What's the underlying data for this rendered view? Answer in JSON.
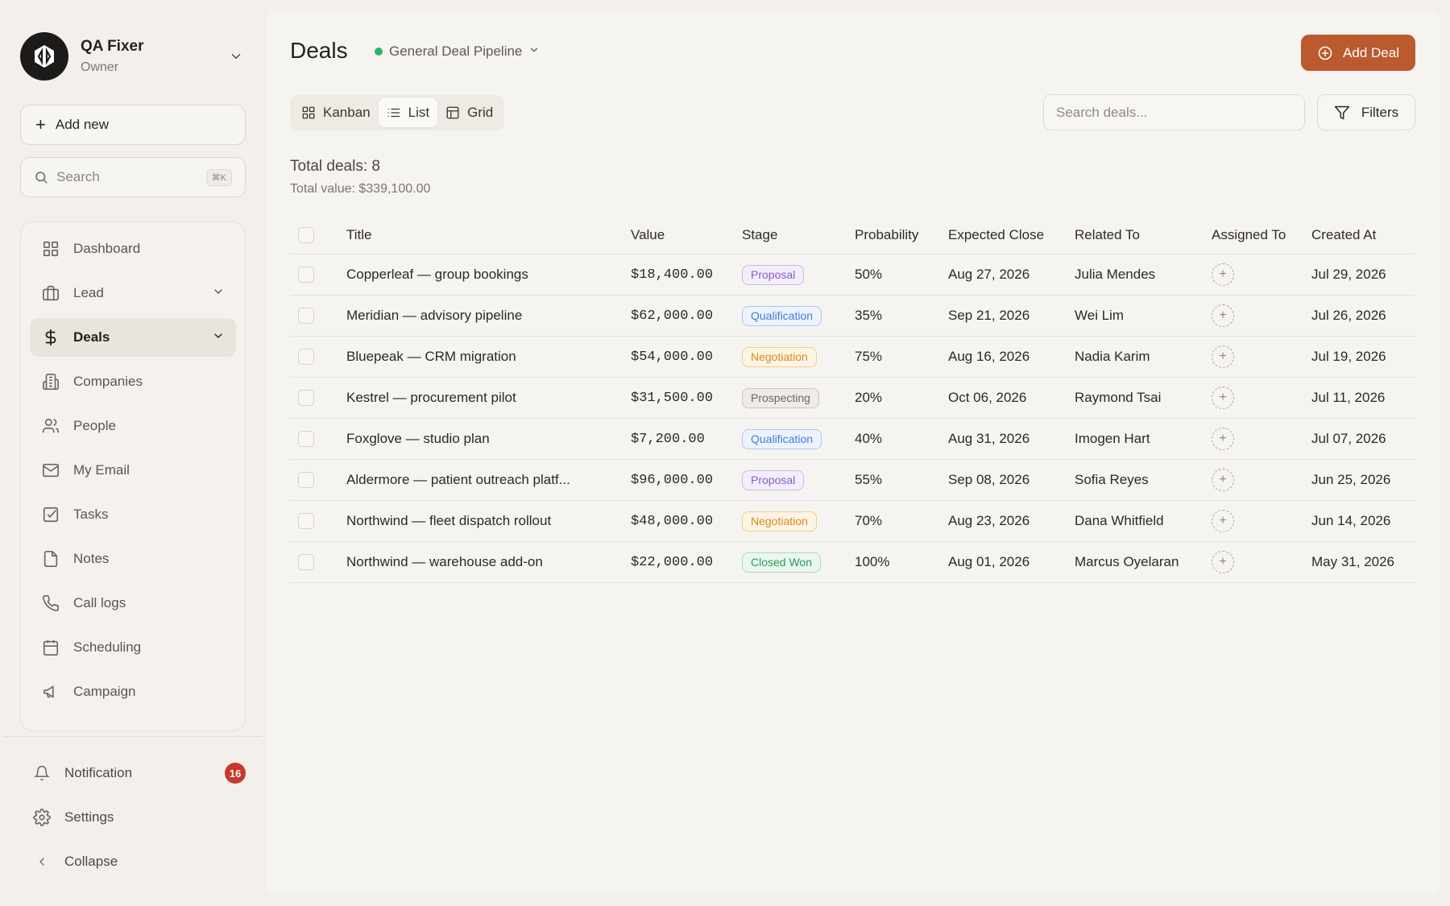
{
  "account": {
    "name": "QA Fixer",
    "role": "Owner"
  },
  "sidebar": {
    "add_new": "Add new",
    "search_placeholder": "Search",
    "search_shortcut": "⌘K",
    "items": [
      {
        "label": "Dashboard",
        "icon": "dashboard-icon"
      },
      {
        "label": "Lead",
        "icon": "briefcase-icon",
        "expandable": true
      },
      {
        "label": "Deals",
        "icon": "dollar-icon",
        "expandable": true,
        "active": true
      },
      {
        "label": "Companies",
        "icon": "building-icon"
      },
      {
        "label": "People",
        "icon": "people-icon"
      },
      {
        "label": "My Email",
        "icon": "mail-icon"
      },
      {
        "label": "Tasks",
        "icon": "task-icon"
      },
      {
        "label": "Notes",
        "icon": "note-icon"
      },
      {
        "label": "Call logs",
        "icon": "phone-icon"
      },
      {
        "label": "Scheduling",
        "icon": "calendar-icon"
      },
      {
        "label": "Campaign",
        "icon": "megaphone-icon"
      }
    ],
    "notification": {
      "label": "Notification",
      "count": "16"
    },
    "settings": "Settings",
    "collapse": "Collapse"
  },
  "header": {
    "title": "Deals",
    "pipeline": "General Deal Pipeline",
    "add_deal": "Add Deal",
    "search_placeholder": "Search deals...",
    "filters": "Filters",
    "views": [
      "Kanban",
      "List",
      "Grid"
    ],
    "active_view": "List"
  },
  "summary": {
    "total_deals": "Total deals: 8",
    "total_value": "Total value: $339,100.00"
  },
  "table": {
    "columns": [
      "Title",
      "Value",
      "Stage",
      "Probability",
      "Expected Close",
      "Related To",
      "Assigned To",
      "Created At"
    ],
    "rows": [
      {
        "title": "Copperleaf — group bookings",
        "value": "$18,400.00",
        "stage": "Proposal",
        "probability": "50%",
        "expected_close": "Aug 27, 2026",
        "related_to": "Julia Mendes",
        "created_at": "Jul 29, 2026"
      },
      {
        "title": "Meridian — advisory pipeline",
        "value": "$62,000.00",
        "stage": "Qualification",
        "probability": "35%",
        "expected_close": "Sep 21, 2026",
        "related_to": "Wei Lim",
        "created_at": "Jul 26, 2026"
      },
      {
        "title": "Bluepeak — CRM migration",
        "value": "$54,000.00",
        "stage": "Negotiation",
        "probability": "75%",
        "expected_close": "Aug 16, 2026",
        "related_to": "Nadia Karim",
        "created_at": "Jul 19, 2026"
      },
      {
        "title": "Kestrel — procurement pilot",
        "value": "$31,500.00",
        "stage": "Prospecting",
        "probability": "20%",
        "expected_close": "Oct 06, 2026",
        "related_to": "Raymond Tsai",
        "created_at": "Jul 11, 2026"
      },
      {
        "title": "Foxglove — studio plan",
        "value": "$7,200.00",
        "stage": "Qualification",
        "probability": "40%",
        "expected_close": "Aug 31, 2026",
        "related_to": "Imogen Hart",
        "created_at": "Jul 07, 2026"
      },
      {
        "title": "Aldermore — patient outreach platf...",
        "value": "$96,000.00",
        "stage": "Proposal",
        "probability": "55%",
        "expected_close": "Sep 08, 2026",
        "related_to": "Sofia Reyes",
        "created_at": "Jun 25, 2026"
      },
      {
        "title": "Northwind — fleet dispatch rollout",
        "value": "$48,000.00",
        "stage": "Negotiation",
        "probability": "70%",
        "expected_close": "Aug 23, 2026",
        "related_to": "Dana Whitfield",
        "created_at": "Jun 14, 2026"
      },
      {
        "title": "Northwind — warehouse add-on",
        "value": "$22,000.00",
        "stage": "Closed Won",
        "probability": "100%",
        "expected_close": "Aug 01, 2026",
        "related_to": "Marcus Oyelaran",
        "created_at": "May 31, 2026"
      }
    ]
  },
  "stage_colors": {
    "Proposal": {
      "text": "#8b5cc9",
      "border": "#cdb6ee",
      "bg": "#f3eefb"
    },
    "Qualification": {
      "text": "#3f7fd6",
      "border": "#a9c8f0",
      "bg": "#edf3fc"
    },
    "Negotiation": {
      "text": "#d98a1e",
      "border": "#f0cc8e",
      "bg": "#fdf4e4"
    },
    "Prospecting": {
      "text": "#6b665f",
      "border": "#c9c4bc",
      "bg": "#efece7"
    },
    "Closed Won": {
      "text": "#2a9a5c",
      "border": "#a7dbbd",
      "bg": "#eaf7ef"
    }
  },
  "colors": {
    "accent": "#bb5a2e",
    "badge": "#c8372d",
    "pipeline_dot": "#2fb36d"
  }
}
